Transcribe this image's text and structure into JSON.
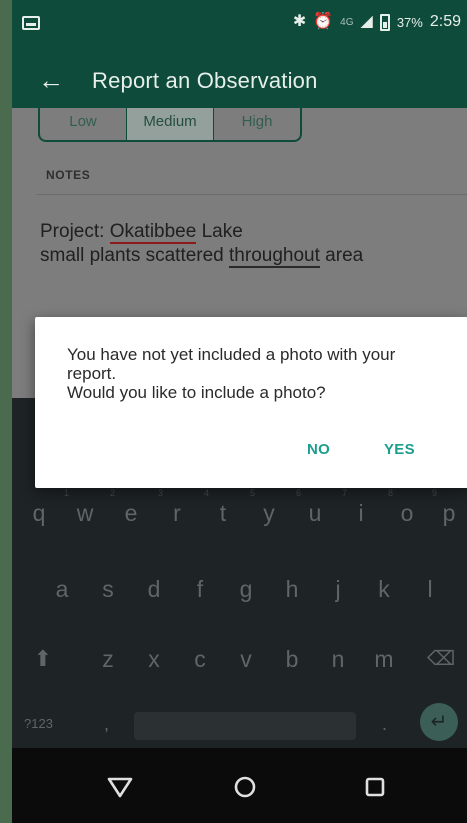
{
  "status_bar": {
    "battery_percent": "37%",
    "time": "2:59",
    "carrier_small": "4G",
    "icons": [
      "screenshot-icon",
      "bluetooth-icon",
      "alarm-icon",
      "signal-icon",
      "battery-icon"
    ]
  },
  "app_bar": {
    "title": "Report an Observation",
    "back_icon": "arrow-left-icon"
  },
  "severity": {
    "options": [
      "Low",
      "Medium",
      "High"
    ],
    "selected": "Medium"
  },
  "notes": {
    "section_label": "NOTES",
    "line1_prefix": "Project: ",
    "line1_underlined": "Okatibbee",
    "line1_suffix": " Lake",
    "line2_prefix": "small plants scattered ",
    "line2_underlined": "throughout",
    "line2_suffix": " area"
  },
  "dialog": {
    "message_line1": "You have not yet included a photo with your report.",
    "message_line2": "Would you like to include a photo?",
    "no_label": "NO",
    "yes_label": "YES"
  },
  "keyboard": {
    "row1": [
      "q",
      "w",
      "e",
      "r",
      "t",
      "y",
      "u",
      "i",
      "o",
      "p"
    ],
    "row1_numbers": [
      "1",
      "2",
      "3",
      "4",
      "5",
      "6",
      "7",
      "8",
      "9"
    ],
    "row2": [
      "a",
      "s",
      "d",
      "f",
      "g",
      "h",
      "j",
      "k",
      "l"
    ],
    "row3": [
      "z",
      "x",
      "c",
      "v",
      "b",
      "n",
      "m"
    ],
    "symbols_label": "?123",
    "comma": ",",
    "period": "."
  },
  "nav": {
    "icons": [
      "back-triangle-icon",
      "home-circle-icon",
      "recents-square-icon"
    ]
  },
  "colors": {
    "app_bar": "#0f4b3a",
    "accent": "#1c9e8f",
    "keyboard": "#1e2325"
  }
}
